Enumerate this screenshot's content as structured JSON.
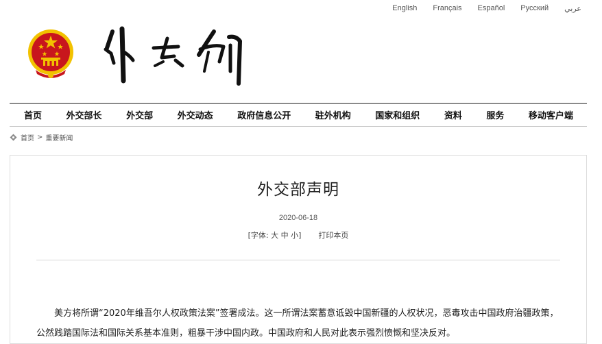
{
  "languages": [
    "English",
    "Français",
    "Español",
    "Русский",
    "عربي"
  ],
  "nav": [
    "首页",
    "外交部长",
    "外交部",
    "外交动态",
    "政府信息公开",
    "驻外机构",
    "国家和组织",
    "资料",
    "服务",
    "移动客户端"
  ],
  "breadcrumb": {
    "home": "首页",
    "separator": ">",
    "current": "重要新闻"
  },
  "article": {
    "title": "外交部声明",
    "date": "2020-06-18",
    "font_label": "[字体:",
    "font_large": "大",
    "font_medium": "中",
    "font_small": "小]",
    "print": "打印本页",
    "paragraph": "美方将所谓“2020年维吾尔人权政策法案”签署成法。这一所谓法案蓄意诋毁中国新疆的人权状况，恶毒攻击中国政府治疆政策，公然践踏国际法和国际关系基本准则，粗暴干涉中国内政。中国政府和人民对此表示强烈愤慨和坚决反对。"
  },
  "colors": {
    "emblem_red": "#c8161d",
    "emblem_gold": "#f2c200",
    "nav_line": "#8a8a8a"
  },
  "icons": {
    "emblem": "national-emblem-icon",
    "logo": "ministry-calligraphy-logo",
    "breadcrumb": "location-icon"
  }
}
